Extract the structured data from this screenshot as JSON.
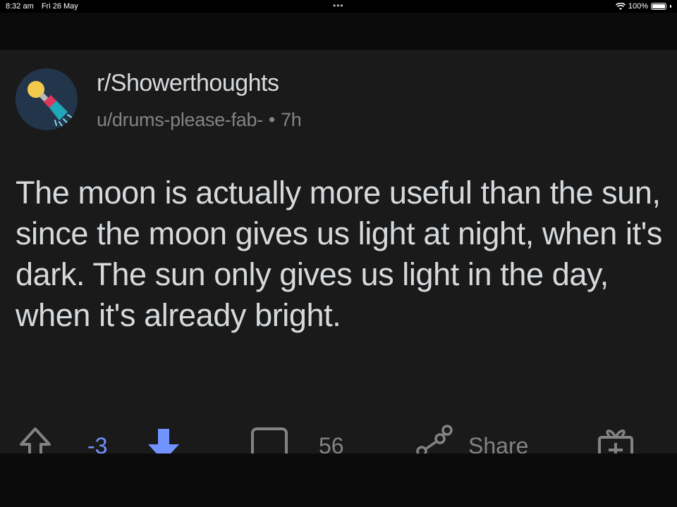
{
  "status_bar": {
    "time": "8:32 am",
    "date": "Fri 26 May",
    "battery": "100%",
    "battery_level": 1.0
  },
  "post": {
    "subreddit": "r/Showerthoughts",
    "author": "u/drums-please-fab-",
    "separator": "•",
    "age": "7h",
    "body": "The moon is actually more useful than the sun, since the moon gives us light at night, when it's dark. The sun only gives us light in the day, when it's already bright."
  },
  "actions": {
    "vote_count": "-3",
    "comment_count": "56",
    "share_label": "Share"
  },
  "colors": {
    "background": "#1a1a1b",
    "text": "#d7dadc",
    "muted": "#818384",
    "downvote_active": "#7193ff",
    "avatar_bg": "#23354a"
  },
  "icons": {
    "avatar": "lightbulb-shower-icon",
    "upvote": "upvote-arrow-icon",
    "downvote": "downvote-arrow-icon",
    "comment": "comment-bubble-icon",
    "share": "share-icon",
    "award": "gift-award-icon",
    "wifi": "wifi-icon",
    "battery": "battery-icon"
  }
}
